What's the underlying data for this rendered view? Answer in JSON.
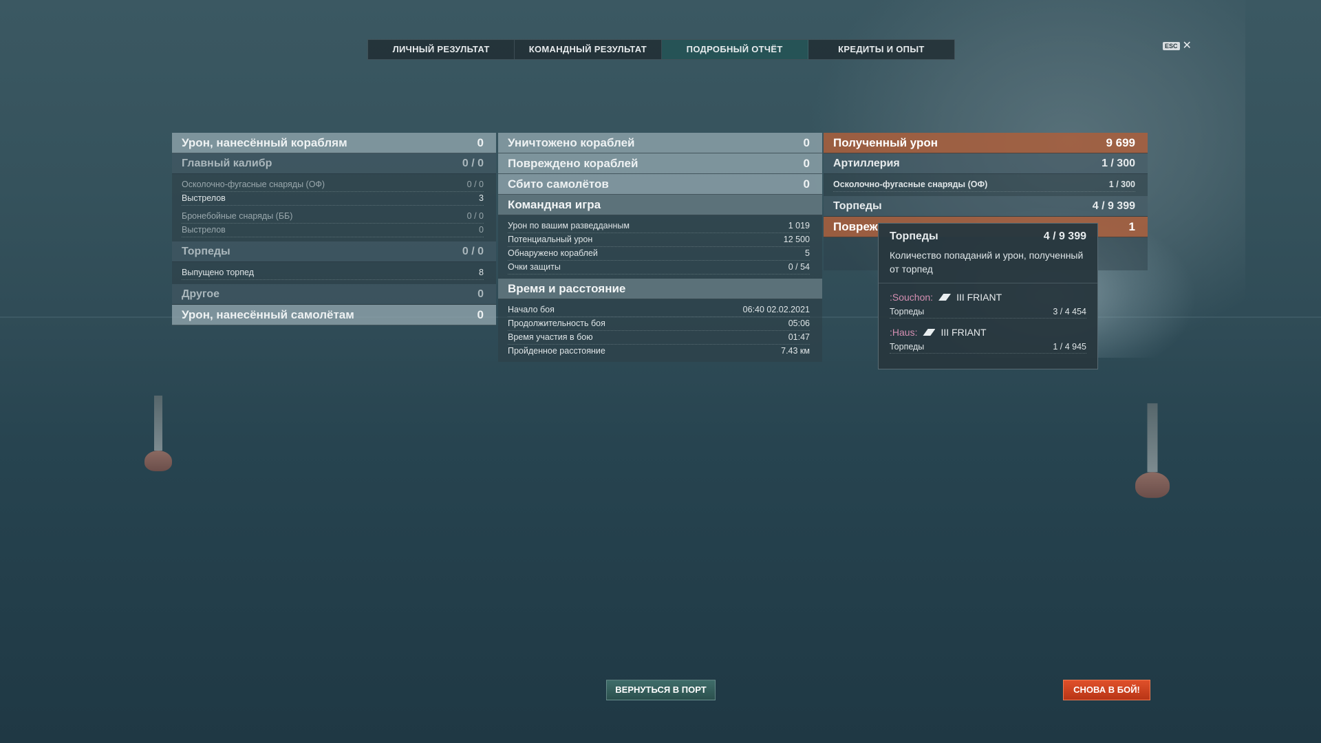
{
  "tabs": [
    "ЛИЧНЫЙ РЕЗУЛЬТАТ",
    "КОМАНДНЫЙ РЕЗУЛЬТАТ",
    "ПОДРОБНЫЙ ОТЧЁТ",
    "КРЕДИТЫ И ОПЫТ"
  ],
  "active_tab": "ПОДРОБНЫЙ ОТЧЁТ",
  "esc": {
    "key": "ESC",
    "close": "✕"
  },
  "col1": {
    "ship_damage": {
      "label": "Урон, нанесённый кораблям",
      "value": "0"
    },
    "main_battery": {
      "label": "Главный калибр",
      "value": "0 / 0"
    },
    "he_shells": {
      "label": "Осколочно-фугасные снаряды (ОФ)",
      "value": "0 / 0"
    },
    "he_shots": {
      "label": "Выстрелов",
      "value": "3"
    },
    "ap_shells": {
      "label": "Бронебойные снаряды (ББ)",
      "value": "0 / 0"
    },
    "ap_shots": {
      "label": "Выстрелов",
      "value": "0"
    },
    "torpedoes": {
      "label": "Торпеды",
      "value": "0 / 0"
    },
    "torpedoes_launched": {
      "label": "Выпущено торпед",
      "value": "8"
    },
    "other": {
      "label": "Другое",
      "value": "0"
    },
    "aircraft_damage": {
      "label": "Урон, нанесённый самолётам",
      "value": "0"
    }
  },
  "col2": {
    "destroyed": {
      "label": "Уничтожено кораблей",
      "value": "0"
    },
    "damaged": {
      "label": "Повреждено кораблей",
      "value": "0"
    },
    "planes": {
      "label": "Сбито самолётов",
      "value": "0"
    },
    "team": {
      "label": "Командная игра",
      "rows": [
        {
          "label": "Урон по вашим разведданным",
          "value": "1 019"
        },
        {
          "label": "Потенциальный урон",
          "value": "12 500"
        },
        {
          "label": "Обнаружено кораблей",
          "value": "5"
        },
        {
          "label": "Очки защиты",
          "value": "0 / 54"
        }
      ]
    },
    "time": {
      "label": "Время и расстояние",
      "rows": [
        {
          "label": "Начало боя",
          "value": "06:40  02.02.2021"
        },
        {
          "label": "Продолжительность боя",
          "value": "05:06"
        },
        {
          "label": "Время участия в бою",
          "value": "01:47"
        },
        {
          "label": "Пройденное расстояние",
          "value": "7.43 км"
        }
      ]
    }
  },
  "col3": {
    "received": {
      "label": "Полученный урон",
      "value": "9 699"
    },
    "artillery": {
      "label": "Артиллерия",
      "value": "1 / 300"
    },
    "he": {
      "label": "Осколочно-фугасные снаряды (ОФ)",
      "value": "1 / 300"
    },
    "torpedoes": {
      "label": "Торпеды",
      "value": "4 / 9 399"
    },
    "damaged": {
      "label": "Повреж",
      "value": "1"
    }
  },
  "tooltip": {
    "title": "Торпеды",
    "value": "4 / 9 399",
    "desc": "Количество попаданий и урон, полученный от торпед",
    "players": [
      {
        "name": ":Souchon:",
        "ship": "III FRIANT",
        "label": "Торпеды",
        "value": "3 / 4 454"
      },
      {
        "name": ":Haus:",
        "ship": "III FRIANT",
        "label": "Торпеды",
        "value": "1 / 4 945"
      }
    ]
  },
  "buttons": {
    "port": "ВЕРНУТЬСЯ В ПОРТ",
    "battle": "СНОВА В БОЙ!"
  },
  "colors": {
    "accent": "#2f6e6c",
    "received_damage": "#ac5f3c",
    "battle_button": "#d9441f",
    "player_name": "#d58fb2"
  }
}
